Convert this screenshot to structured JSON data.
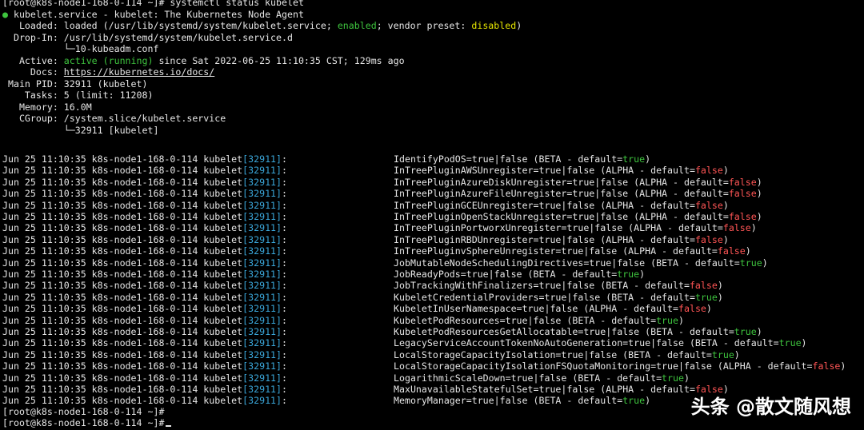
{
  "prompt": "[root@k8s-node1-168-0-114 ~]#",
  "command": " systemctl status kubelet",
  "status": {
    "bullet": "●",
    "unit_line": " kubelet.service - kubelet: The Kubernetes Node Agent",
    "loaded_label": "   Loaded: ",
    "loaded_pre": "loaded (/usr/lib/systemd/system/kubelet.service; ",
    "loaded_enabled": "enabled",
    "loaded_mid": "; vendor preset: ",
    "loaded_disabled": "disabled",
    "loaded_post": ")",
    "dropin_label": "  Drop-In: ",
    "dropin_value": "/usr/lib/systemd/system/kubelet.service.d",
    "dropin_file": "           └─10-kubeadm.conf",
    "active_label": "   Active: ",
    "active_state": "active (running)",
    "active_rest": " since Sat 2022-06-25 11:10:35 CST; 129ms ago",
    "docs_label": "     Docs: ",
    "docs_value": "https://kubernetes.io/docs/",
    "pid_line": " Main PID: 32911 (kubelet)",
    "tasks_line": "    Tasks: 5 (limit: 11208)",
    "memory_line": "   Memory: 16.0M",
    "cgroup_line": "   CGroup: /system.slice/kubelet.service",
    "cgroup_proc": "           └─32911 [kubelet]"
  },
  "log": {
    "prefix": "Jun 25 11:10:35 k8s-node1-168-0-114 kubelet",
    "pid": "[32911]",
    "suffix": ":",
    "default_prefix": " - default=",
    "entries": [
      {
        "feature": "IdentifyPodOS=true|false (",
        "stage": "BETA",
        "default": "true"
      },
      {
        "feature": "InTreePluginAWSUnregister=true|false (",
        "stage": "ALPHA",
        "default": "false"
      },
      {
        "feature": "InTreePluginAzureDiskUnregister=true|false (",
        "stage": "ALPHA",
        "default": "false"
      },
      {
        "feature": "InTreePluginAzureFileUnregister=true|false (",
        "stage": "ALPHA",
        "default": "false"
      },
      {
        "feature": "InTreePluginGCEUnregister=true|false (",
        "stage": "ALPHA",
        "default": "false"
      },
      {
        "feature": "InTreePluginOpenStackUnregister=true|false (",
        "stage": "ALPHA",
        "default": "false"
      },
      {
        "feature": "InTreePluginPortworxUnregister=true|false (",
        "stage": "ALPHA",
        "default": "false"
      },
      {
        "feature": "InTreePluginRBDUnregister=true|false (",
        "stage": "ALPHA",
        "default": "false"
      },
      {
        "feature": "InTreePluginvSphereUnregister=true|false (",
        "stage": "ALPHA",
        "default": "false"
      },
      {
        "feature": "JobMutableNodeSchedulingDirectives=true|false (",
        "stage": "BETA",
        "default": "true"
      },
      {
        "feature": "JobReadyPods=true|false (",
        "stage": "BETA",
        "default": "true"
      },
      {
        "feature": "JobTrackingWithFinalizers=true|false (",
        "stage": "BETA",
        "default": "false"
      },
      {
        "feature": "KubeletCredentialProviders=true|false (",
        "stage": "BETA",
        "default": "true"
      },
      {
        "feature": "KubeletInUserNamespace=true|false (",
        "stage": "ALPHA",
        "default": "false"
      },
      {
        "feature": "KubeletPodResources=true|false (",
        "stage": "BETA",
        "default": "true"
      },
      {
        "feature": "KubeletPodResourcesGetAllocatable=true|false (",
        "stage": "BETA",
        "default": "true"
      },
      {
        "feature": "LegacyServiceAccountTokenNoAutoGeneration=true|false (",
        "stage": "BETA",
        "default": "true"
      },
      {
        "feature": "LocalStorageCapacityIsolation=true|false (",
        "stage": "BETA",
        "default": "true"
      },
      {
        "feature": "LocalStorageCapacityIsolationFSQuotaMonitoring=true|false (",
        "stage": "ALPHA",
        "default": "false"
      },
      {
        "feature": "LogarithmicScaleDown=true|false (",
        "stage": "BETA",
        "default": "true"
      },
      {
        "feature": "MaxUnavailableStatefulSet=true|false (",
        "stage": "ALPHA",
        "default": "false"
      },
      {
        "feature": "MemoryManager=true|false (",
        "stage": "BETA",
        "default": "true"
      }
    ]
  },
  "watermark": "头条 @散文随风想",
  "colors": {
    "background": "#000000",
    "text": "#e6e6e6",
    "green": "#3ec43e",
    "yellow": "#e6e600",
    "cyan": "#3aa6d9",
    "red": "#ff5555"
  }
}
